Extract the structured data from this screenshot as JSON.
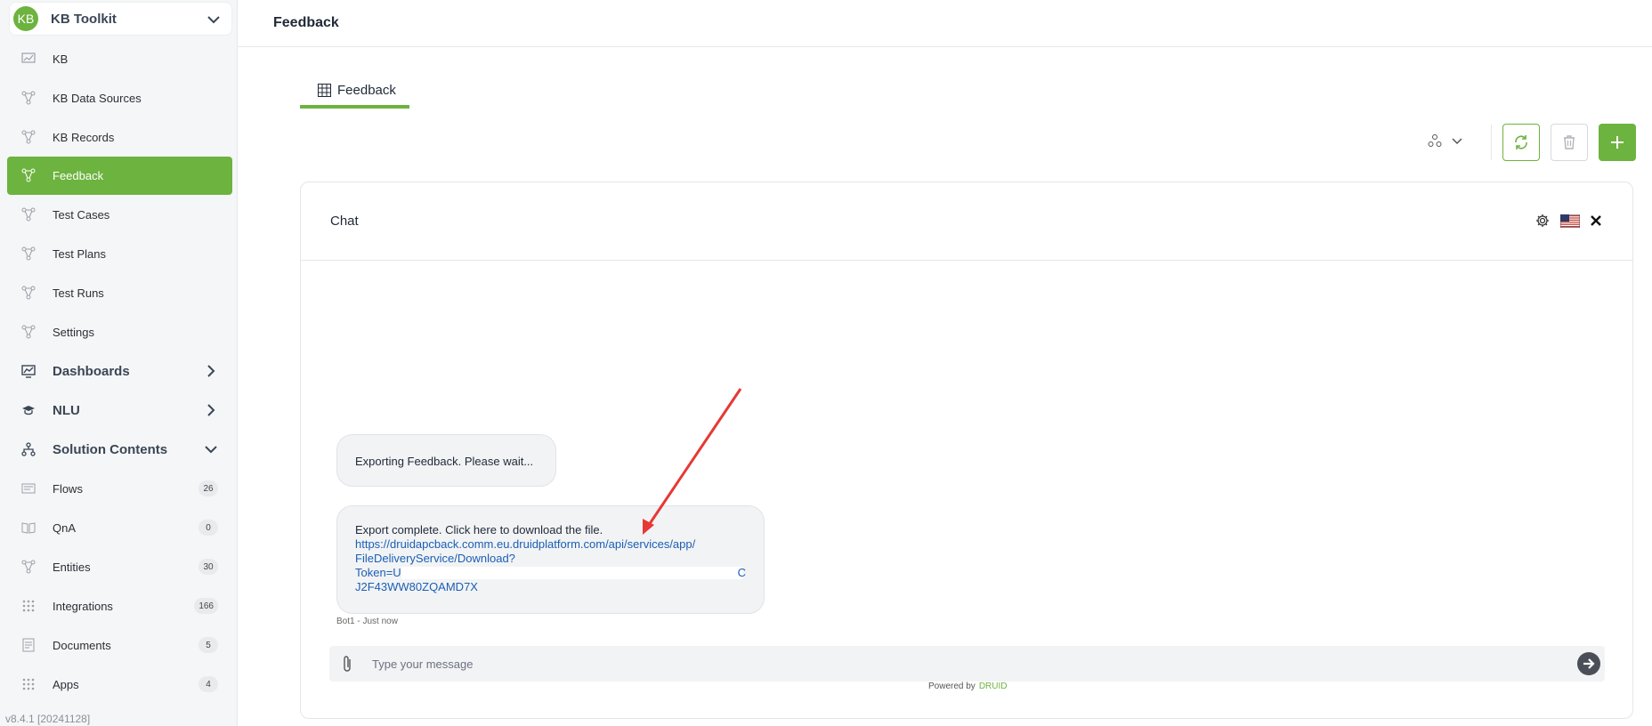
{
  "sidebar": {
    "header": {
      "avatar": "KB",
      "title": "KB Toolkit"
    },
    "items": [
      {
        "label": "KB",
        "icon": "chart-icon"
      },
      {
        "label": "KB Data Sources",
        "icon": "graph-icon"
      },
      {
        "label": "KB Records",
        "icon": "graph-icon"
      },
      {
        "label": "Feedback",
        "icon": "graph-icon",
        "active": true
      },
      {
        "label": "Test Cases",
        "icon": "graph-icon"
      },
      {
        "label": "Test Plans",
        "icon": "graph-icon"
      },
      {
        "label": "Test Runs",
        "icon": "graph-icon"
      },
      {
        "label": "Settings",
        "icon": "graph-icon"
      }
    ],
    "sections": [
      {
        "label": "Dashboards",
        "icon": "dashboard-icon"
      },
      {
        "label": "NLU",
        "icon": "graduation-cap-icon"
      },
      {
        "label": "Solution Contents",
        "icon": "hierarchy-icon"
      }
    ],
    "contents": [
      {
        "label": "Flows",
        "badge": "26"
      },
      {
        "label": "QnA",
        "badge": "0"
      },
      {
        "label": "Entities",
        "badge": "30"
      },
      {
        "label": "Integrations",
        "badge": "166"
      },
      {
        "label": "Documents",
        "badge": "5"
      },
      {
        "label": "Apps",
        "badge": "4"
      }
    ],
    "version": "v8.4.1 [20241128]"
  },
  "header": {
    "title": "Feedback"
  },
  "tabs": [
    {
      "label": "Feedback",
      "icon": "table-icon"
    }
  ],
  "chat": {
    "title": "Chat",
    "messages": {
      "m1": "Exporting Feedback. Please wait...",
      "m2_text": "Export complete. Click here to download the file.",
      "m2_link_line1": "https://druidapcback.comm.eu.druidplatform.com/api/services/app/",
      "m2_link_line2": "FileDeliveryService/Download?",
      "m2_token_prefix": "Token=U",
      "m2_token_suffix": "C",
      "m2_link_line4": "J2F43WW80ZQAMD7X"
    },
    "meta": "Bot1 - Just now",
    "composer": {
      "placeholder": "Type your message"
    },
    "powered_by": "Powered by",
    "brand": "DRUID"
  },
  "colors": {
    "accent": "#6db33f",
    "link": "#1a5fb4",
    "annotation_arrow": "#e53935"
  }
}
